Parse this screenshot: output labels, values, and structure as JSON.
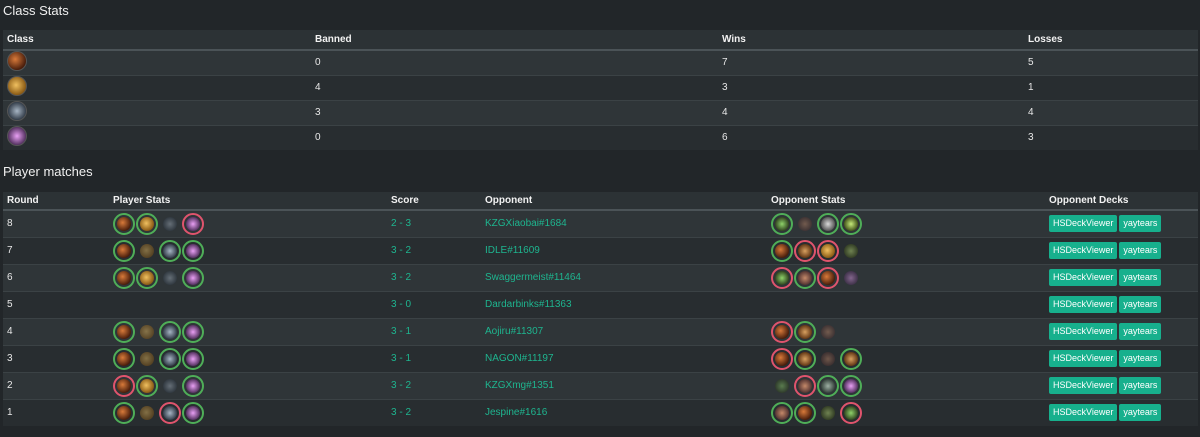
{
  "class_stats": {
    "title": "Class Stats",
    "headers": [
      "Class",
      "Banned",
      "Wins",
      "Losses"
    ],
    "rows": [
      {
        "class_icon": "rogue",
        "banned": "0",
        "wins": "7",
        "losses": "5"
      },
      {
        "class_icon": "paladin",
        "banned": "4",
        "wins": "3",
        "losses": "1"
      },
      {
        "class_icon": "mage",
        "banned": "3",
        "wins": "4",
        "losses": "4"
      },
      {
        "class_icon": "demon-hunter",
        "banned": "0",
        "wins": "6",
        "losses": "3"
      }
    ]
  },
  "player_matches": {
    "title": "Player matches",
    "headers": [
      "Round",
      "Player Stats",
      "Score",
      "Opponent",
      "Opponent Stats",
      "Opponent Decks"
    ],
    "deck_buttons": [
      "HSDeckViewer",
      "yaytears"
    ],
    "rows": [
      {
        "round": "8",
        "score": "2 - 3",
        "opponent": "KZGXiaobai#1684",
        "player_icons": [
          [
            "rogue",
            "win"
          ],
          [
            "paladin",
            "win"
          ],
          [
            "mage",
            "ban"
          ],
          [
            "demon-hunter",
            "loss"
          ]
        ],
        "opponent_icons": [
          [
            "druid",
            "win"
          ],
          [
            "warrior",
            "ban"
          ],
          [
            "priest",
            "win"
          ],
          [
            "warlock",
            "win"
          ]
        ]
      },
      {
        "round": "7",
        "score": "3 - 2",
        "opponent": "IDLE#11609",
        "player_icons": [
          [
            "rogue",
            "win"
          ],
          [
            "paladin",
            "ban"
          ],
          [
            "mage",
            "win"
          ],
          [
            "demon-hunter",
            "win"
          ]
        ],
        "opponent_icons": [
          [
            "rogue",
            "win"
          ],
          [
            "hunter",
            "loss"
          ],
          [
            "paladin",
            "loss"
          ],
          [
            "warlock",
            "ban"
          ]
        ]
      },
      {
        "round": "6",
        "score": "3 - 2",
        "opponent": "Swaggermeist#11464",
        "player_icons": [
          [
            "rogue",
            "win"
          ],
          [
            "paladin",
            "win"
          ],
          [
            "mage",
            "ban"
          ],
          [
            "demon-hunter",
            "win"
          ]
        ],
        "opponent_icons": [
          [
            "druid",
            "loss"
          ],
          [
            "warrior",
            "win"
          ],
          [
            "rogue",
            "loss"
          ],
          [
            "demon-hunter",
            "ban"
          ]
        ]
      },
      {
        "round": "5",
        "score": "3 - 0",
        "opponent": "Dardarbinks#11363",
        "player_icons": [],
        "opponent_icons": []
      },
      {
        "round": "4",
        "score": "3 - 1",
        "opponent": "Aojiru#11307",
        "player_icons": [
          [
            "rogue",
            "win"
          ],
          [
            "paladin",
            "ban"
          ],
          [
            "mage",
            "win"
          ],
          [
            "demon-hunter",
            "win"
          ]
        ],
        "opponent_icons": [
          [
            "rogue",
            "loss"
          ],
          [
            "hunter",
            "win"
          ],
          [
            "warrior",
            "ban"
          ]
        ]
      },
      {
        "round": "3",
        "score": "3 - 1",
        "opponent": "NAGON#11197",
        "player_icons": [
          [
            "rogue",
            "win"
          ],
          [
            "paladin",
            "ban"
          ],
          [
            "mage",
            "win"
          ],
          [
            "demon-hunter",
            "win"
          ]
        ],
        "opponent_icons": [
          [
            "rogue",
            "loss"
          ],
          [
            "hunter",
            "win"
          ],
          [
            "warrior",
            "ban"
          ],
          [
            "hunter",
            "win"
          ]
        ]
      },
      {
        "round": "2",
        "score": "3 - 2",
        "opponent": "KZGXmg#1351",
        "player_icons": [
          [
            "rogue",
            "loss"
          ],
          [
            "paladin",
            "win"
          ],
          [
            "mage",
            "ban"
          ],
          [
            "demon-hunter",
            "win"
          ]
        ],
        "opponent_icons": [
          [
            "druid",
            "ban"
          ],
          [
            "warrior",
            "loss"
          ],
          [
            "shaman",
            "win"
          ],
          [
            "demon-hunter",
            "win"
          ]
        ]
      },
      {
        "round": "1",
        "score": "3 - 2",
        "opponent": "Jespine#1616",
        "player_icons": [
          [
            "rogue",
            "win"
          ],
          [
            "paladin",
            "ban"
          ],
          [
            "mage",
            "loss"
          ],
          [
            "demon-hunter",
            "win"
          ]
        ],
        "opponent_icons": [
          [
            "warrior",
            "win"
          ],
          [
            "rogue",
            "win"
          ],
          [
            "warlock",
            "ban"
          ],
          [
            "druid",
            "loss"
          ]
        ]
      }
    ]
  },
  "colors": {
    "background": "#222629",
    "link": "#1eb58f",
    "button": "#17b08d",
    "win_ring": "#4fae58",
    "loss_ring": "#e0546d"
  }
}
